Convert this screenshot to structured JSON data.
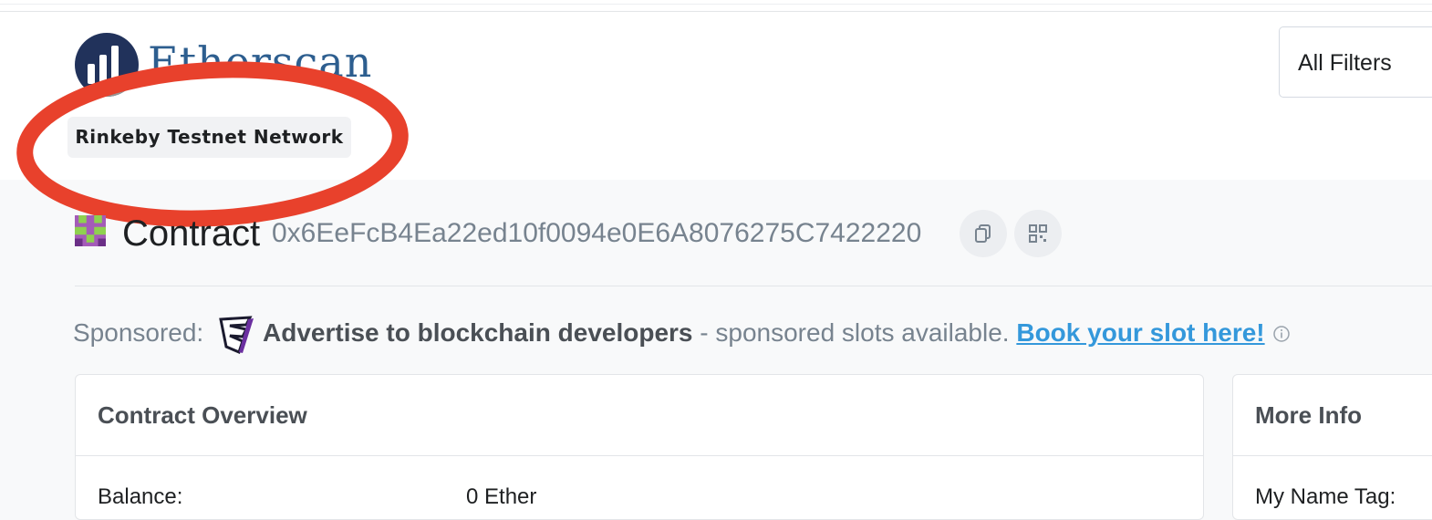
{
  "header": {
    "logo_text": "Etherscan",
    "network_badge": "Rinkeby Testnet Network",
    "filter_select_value": "All Filters"
  },
  "contract": {
    "label": "Contract",
    "address": "0x6EeFcB4Ea22ed10f0094e0E6A8076275C7422220",
    "copy_icon": "copy-icon",
    "qr_icon": "qr-code-icon"
  },
  "sponsored": {
    "label": "Sponsored:",
    "headline": "Advertise to blockchain developers",
    "text": " - sponsored slots available. ",
    "link": "Book your slot here!",
    "info_icon": "info-icon"
  },
  "overview": {
    "title": "Contract Overview",
    "balance_label": "Balance:",
    "balance_value": "0 Ether"
  },
  "more_info": {
    "title": "More Info",
    "name_tag_label": "My Name Tag:"
  },
  "colors": {
    "accent_link": "#3498db",
    "annotation_red": "#e8412c",
    "logo_blue": "#21325b"
  }
}
